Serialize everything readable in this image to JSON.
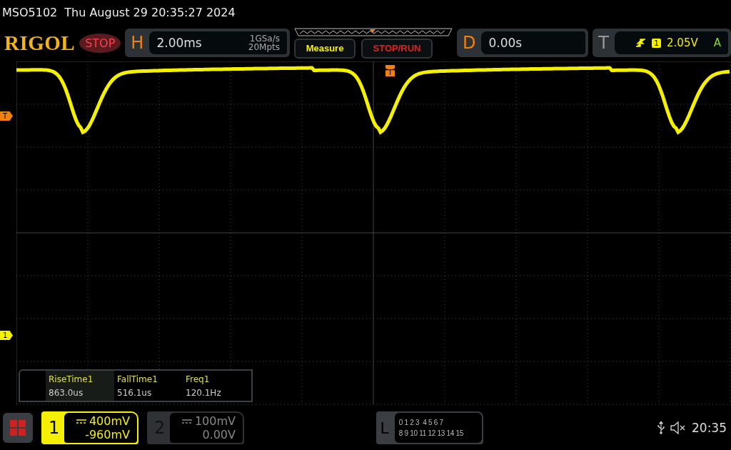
{
  "title_bar": {
    "model": "MSO5102",
    "datetime": "Thu August 29 20:35:27 2024"
  },
  "header": {
    "logo": "RIGOL",
    "run_state": "STOP",
    "horizontal": {
      "label": "H",
      "timebase": "2.00ms",
      "sample_rate": "1GSa/s",
      "memory_depth": "20Mpts"
    },
    "buttons": [
      {
        "label": "Measure",
        "kind": "measure"
      },
      {
        "label": "STOP/RUN",
        "kind": "run"
      }
    ],
    "delay": {
      "label": "D",
      "value": "0.00s"
    },
    "trigger": {
      "label": "T",
      "source": "1",
      "level": "2.05V",
      "mode": "A"
    }
  },
  "markers": {
    "trigger_level": "T",
    "trigger_position": "T",
    "channel": "1"
  },
  "measurements": [
    {
      "label": "RiseTime1",
      "value": "863.0us",
      "selected": true
    },
    {
      "label": "FallTime1",
      "value": "516.1us",
      "selected": false
    },
    {
      "label": "Freq1",
      "value": "120.1Hz",
      "selected": false
    }
  ],
  "channels": [
    {
      "number": "1",
      "active": true,
      "scale": "400mV",
      "offset": "-960mV"
    },
    {
      "number": "2",
      "active": false,
      "scale": "100mV",
      "offset": "0.00V"
    }
  ],
  "logic": {
    "label": "L",
    "rows": [
      "0 1 2 3  4 5 6 7",
      "8 9 10 11 12 13 14 15"
    ]
  },
  "status": {
    "time": "20:35"
  }
}
